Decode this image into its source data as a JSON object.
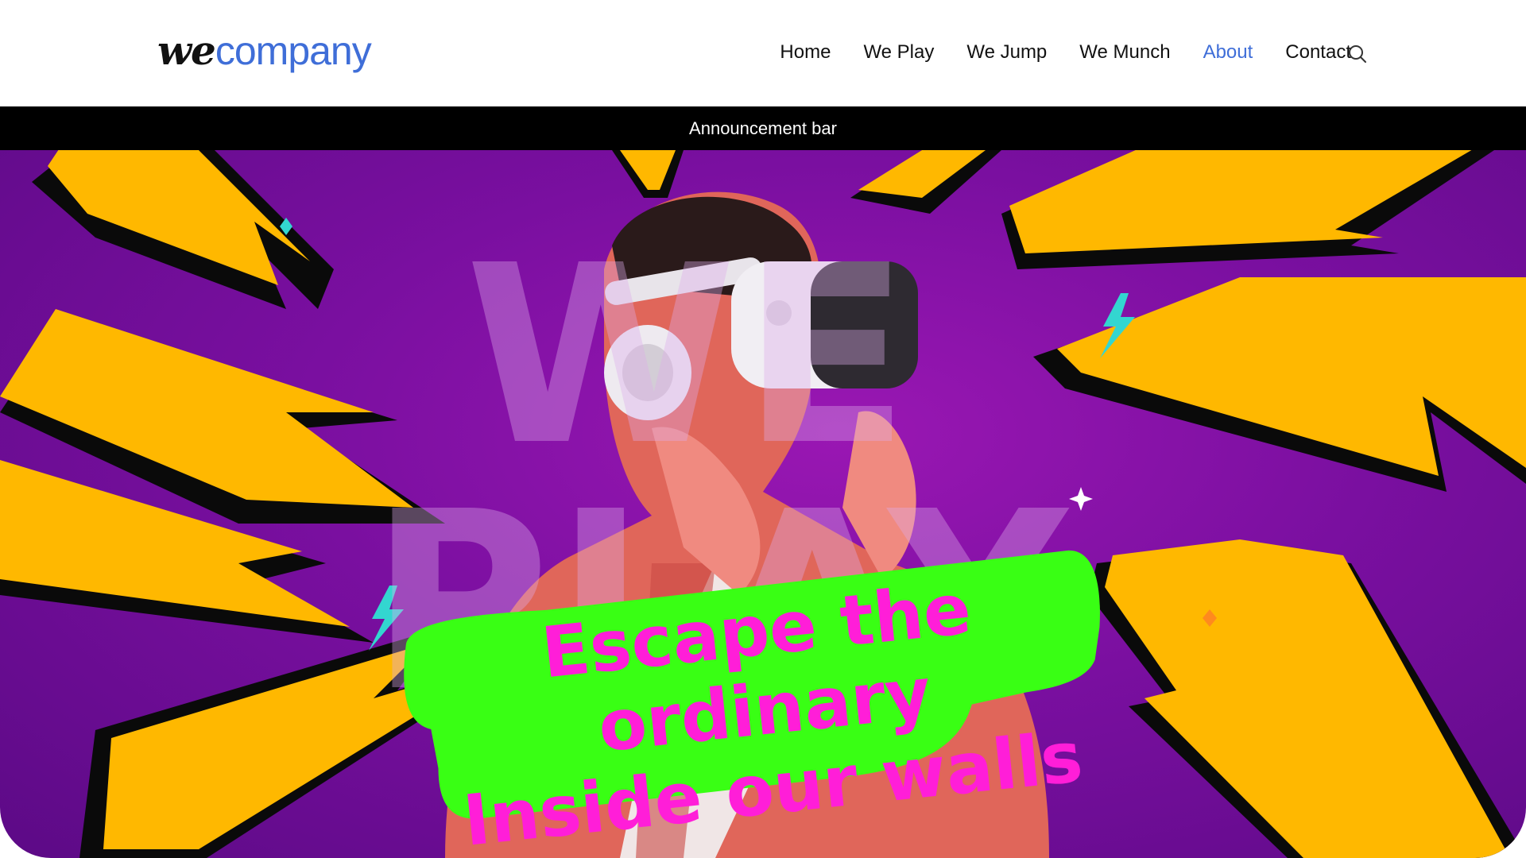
{
  "header": {
    "logo": {
      "we": "we",
      "company": "company"
    },
    "nav": [
      {
        "label": "Home",
        "active": false
      },
      {
        "label": "We Play",
        "active": false
      },
      {
        "label": "We Jump",
        "active": false
      },
      {
        "label": "We Munch",
        "active": false
      },
      {
        "label": "About",
        "active": true
      },
      {
        "label": "Contact",
        "active": false
      }
    ],
    "search_icon": "search-icon"
  },
  "announcement": {
    "text": "Announcement bar"
  },
  "hero": {
    "watermark_line1": "WE",
    "watermark_line2": "PLAY",
    "tagline_line1": "Escape the ordinary",
    "tagline_line2": "Inside our walls",
    "image": "person-wearing-vr-headset"
  },
  "colors": {
    "accent": "#3f6ed8",
    "hero_purple": "#7a0fa0",
    "bolt_yellow": "#ffb800",
    "tagline_pink": "#ff1ed8",
    "tagline_green": "#39ff14",
    "announcement_bg": "#000000"
  }
}
